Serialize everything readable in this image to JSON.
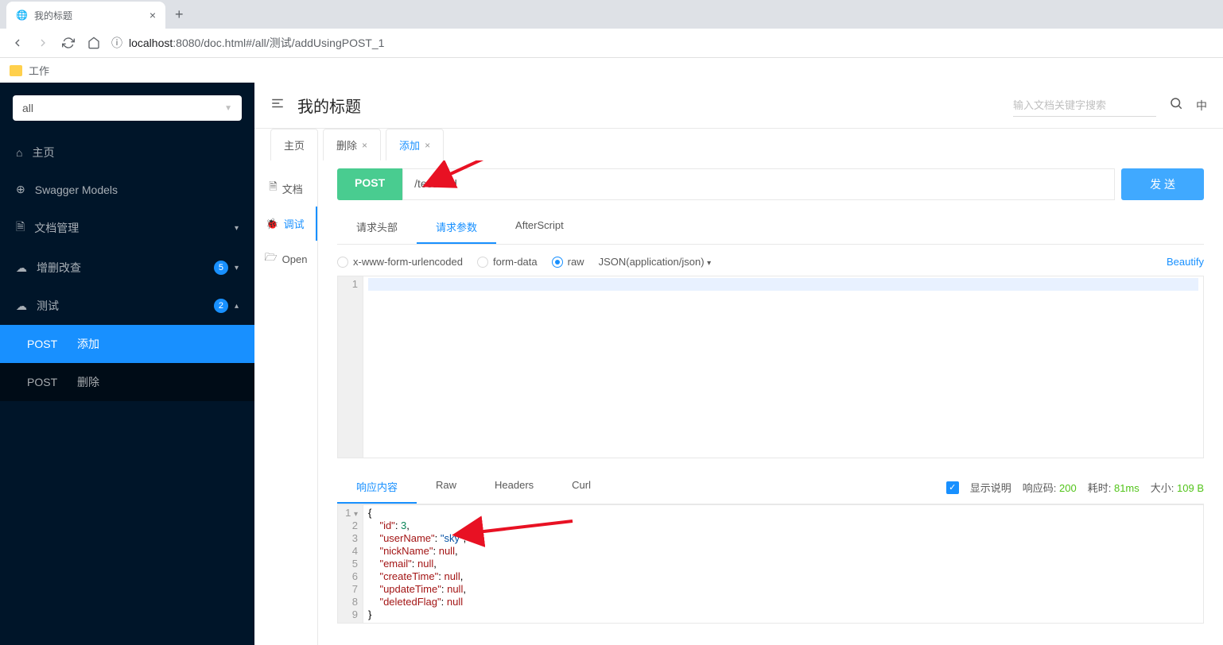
{
  "browser": {
    "tab_title": "我的标题",
    "url_host": "localhost",
    "url_port": ":8080",
    "url_path": "/doc.html#/all/测试/addUsingPOST_1",
    "bookmark": "工作"
  },
  "sidebar": {
    "select_value": "all",
    "items": [
      {
        "label": "主页"
      },
      {
        "label": "Swagger Models"
      },
      {
        "label": "文档管理",
        "expandable": true
      },
      {
        "label": "增删改查",
        "badge": "5",
        "expandable": true
      },
      {
        "label": "测试",
        "badge": "2",
        "expanded": true
      }
    ],
    "subitems": [
      {
        "method": "POST",
        "label": "添加",
        "active": true
      },
      {
        "method": "POST",
        "label": "删除"
      }
    ]
  },
  "header": {
    "title": "我的标题",
    "search_placeholder": "输入文档关键字搜索",
    "lang": "中"
  },
  "tabs": [
    {
      "label": "主页",
      "closable": false
    },
    {
      "label": "删除",
      "closable": true
    },
    {
      "label": "添加",
      "closable": true,
      "active": true
    }
  ],
  "left_nav": [
    {
      "label": "文档"
    },
    {
      "label": "调试",
      "active": true
    },
    {
      "label": "Open"
    }
  ],
  "request": {
    "method": "POST",
    "url": "/test/add",
    "send_label": "发 送"
  },
  "sub_tabs": [
    {
      "label": "请求头部"
    },
    {
      "label": "请求参数",
      "active": true
    },
    {
      "label": "AfterScript"
    }
  ],
  "body_types": {
    "opt1": "x-www-form-urlencoded",
    "opt2": "form-data",
    "opt3": "raw",
    "content_type": "JSON(application/json)",
    "beautify": "Beautify"
  },
  "request_editor": {
    "line1_num": "1"
  },
  "response": {
    "tabs": [
      {
        "label": "响应内容",
        "active": true
      },
      {
        "label": "Raw"
      },
      {
        "label": "Headers"
      },
      {
        "label": "Curl"
      }
    ],
    "show_desc": "显示说明",
    "code_label": "响应码:",
    "code": "200",
    "time_label": "耗时:",
    "time": "81ms",
    "size_label": "大小:",
    "size": "109 B"
  },
  "response_body": {
    "lines": [
      {
        "n": "1",
        "raw": "{"
      },
      {
        "n": "2",
        "key": "id",
        "val": "3",
        "type": "num"
      },
      {
        "n": "3",
        "key": "userName",
        "val": "\"sky\"",
        "type": "str"
      },
      {
        "n": "4",
        "key": "nickName",
        "val": "null",
        "type": "null"
      },
      {
        "n": "5",
        "key": "email",
        "val": "null",
        "type": "null"
      },
      {
        "n": "6",
        "key": "createTime",
        "val": "null",
        "type": "null"
      },
      {
        "n": "7",
        "key": "updateTime",
        "val": "null",
        "type": "null"
      },
      {
        "n": "8",
        "key": "deletedFlag",
        "val": "null",
        "type": "null",
        "last": true
      },
      {
        "n": "9",
        "raw": "}"
      }
    ]
  }
}
